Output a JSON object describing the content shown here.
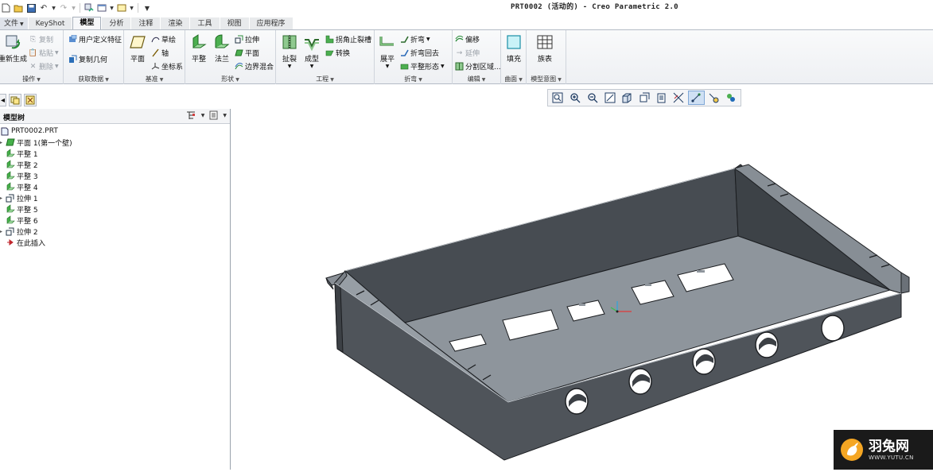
{
  "window": {
    "title": "PRT0002 (活动的) - Creo Parametric 2.0"
  },
  "quick_access": {
    "icons": [
      "new-icon",
      "open-icon",
      "save-icon",
      "undo-icon",
      "redo-icon",
      "regenerate-icon",
      "window-icon",
      "close-window-icon",
      "customize-icon"
    ]
  },
  "tabs": [
    {
      "label": "文件",
      "id": "file"
    },
    {
      "label": "KeyShot",
      "id": "keyshot"
    },
    {
      "label": "模型",
      "id": "model",
      "active": true
    },
    {
      "label": "分析",
      "id": "analysis"
    },
    {
      "label": "注释",
      "id": "annotate"
    },
    {
      "label": "渲染",
      "id": "render"
    },
    {
      "label": "工具",
      "id": "tools"
    },
    {
      "label": "视图",
      "id": "view"
    },
    {
      "label": "应用程序",
      "id": "applications"
    }
  ],
  "ribbon": {
    "operations": {
      "label": "操作",
      "regenerate": "重新生成",
      "copy": "复制",
      "paste": "粘贴",
      "delete": "删除"
    },
    "get_data": {
      "label": "获取数据",
      "udf": "用户定义特征",
      "copy_geom": "复制几何"
    },
    "datum": {
      "label": "基准",
      "plane": "平面",
      "sketch": "草绘",
      "axis": "轴",
      "csys": "坐标系"
    },
    "shapes": {
      "label": "形状",
      "flat": "平整",
      "flange": "法兰",
      "extrude": "拉伸",
      "planar": "平面",
      "blend": "边界混合"
    },
    "engineering": {
      "label": "工程",
      "tear": "扯裂",
      "form": "成型",
      "corner_relief": "拐角止裂槽",
      "convert": "转换"
    },
    "bends": {
      "label": "折弯",
      "unbend": "展平",
      "bend": "折弯",
      "bend_back": "折弯回去",
      "flat_state": "平整形态"
    },
    "editing": {
      "label": "编辑",
      "offset": "偏移",
      "extend": "延伸",
      "split": "分割区域..."
    },
    "surfaces": {
      "label": "曲面",
      "fill": "填充"
    },
    "model_intent": {
      "label": "模型意图",
      "family_table": "族表"
    }
  },
  "model_tree": {
    "title": "模型树",
    "items": [
      {
        "label": "PRT0002.PRT",
        "icon": "part-icon",
        "expander": false
      },
      {
        "label": "平面 1(第一个壁)",
        "icon": "planar-wall-icon",
        "expander": true
      },
      {
        "label": "平整 1",
        "icon": "flat-wall-icon",
        "expander": false
      },
      {
        "label": "平整 2",
        "icon": "flat-wall-icon",
        "expander": false
      },
      {
        "label": "平整 3",
        "icon": "flat-wall-icon",
        "expander": false
      },
      {
        "label": "平整 4",
        "icon": "flat-wall-icon",
        "expander": false
      },
      {
        "label": "拉伸 1",
        "icon": "extrude-icon",
        "expander": true
      },
      {
        "label": "平整 5",
        "icon": "flat-wall-icon",
        "expander": false
      },
      {
        "label": "平整 6",
        "icon": "flat-wall-icon",
        "expander": false
      },
      {
        "label": "拉伸 2",
        "icon": "extrude-icon",
        "expander": true
      },
      {
        "label": "在此插入",
        "icon": "insert-here-icon",
        "expander": false
      }
    ]
  },
  "view_toolbar": {
    "icons": [
      "refit-icon",
      "zoom-in-icon",
      "zoom-out-icon",
      "repaint-icon",
      "display-style-icon",
      "saved-views-icon",
      "view-manager-icon",
      "perspective-icon",
      "datum-display-icon",
      "spin-center-icon",
      "annotation-display-icon"
    ]
  },
  "watermark": {
    "cn": "羽兔网",
    "url": "WWW.YUTU.CN"
  },
  "colors": {
    "part_dark": "#4a4f55",
    "part_light": "#8d949b",
    "tab_active_bg": "#f6f7f9"
  }
}
